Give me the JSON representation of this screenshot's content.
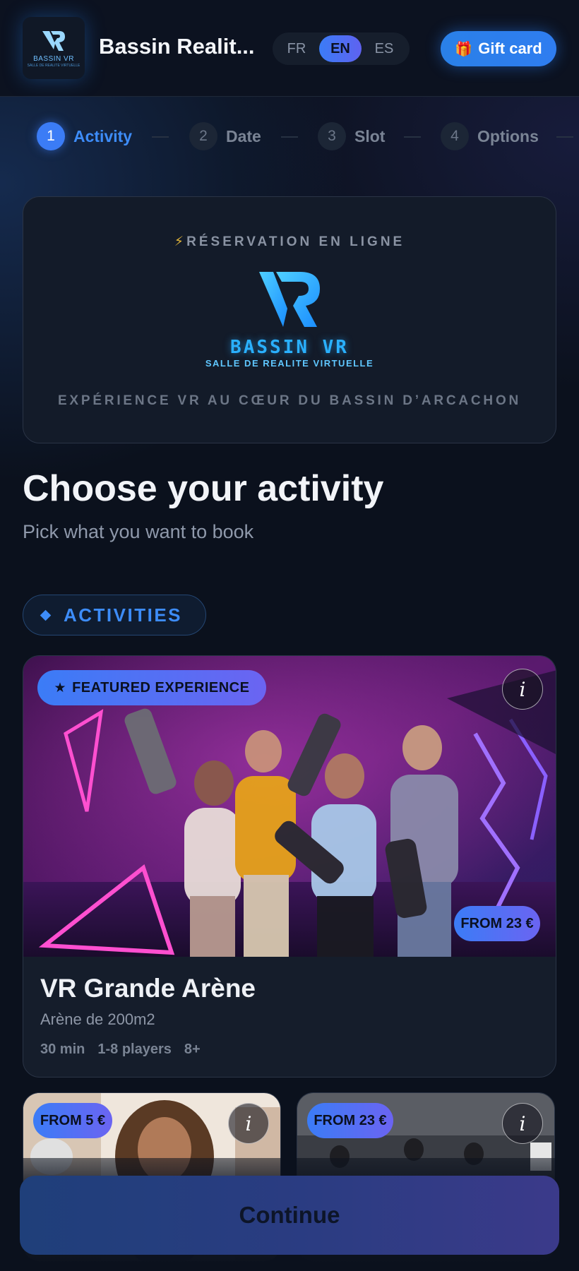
{
  "header": {
    "logo_text": "BASSIN VR",
    "logo_subtext": "SALLE DE REALITE VIRTUELLE",
    "brand_name": "Bassin Realit...",
    "languages": [
      "FR",
      "EN",
      "ES"
    ],
    "active_language": "EN",
    "gift_card_label": "Gift card",
    "gift_icon": "gift-icon"
  },
  "stepper": {
    "steps": [
      {
        "number": "1",
        "label": "Activity",
        "active": true
      },
      {
        "number": "2",
        "label": "Date",
        "active": false
      },
      {
        "number": "3",
        "label": "Slot",
        "active": false
      },
      {
        "number": "4",
        "label": "Options",
        "active": false
      }
    ]
  },
  "hero": {
    "kicker_icon": "⚡",
    "kicker": "RÉSERVATION EN LIGNE",
    "brand": "BASSIN VR",
    "brand_sub": "SALLE DE REALITE VIRTUELLE",
    "tagline": "EXPÉRIENCE VR AU CŒUR DU BASSIN D’ARCACHON"
  },
  "main": {
    "title": "Choose your activity",
    "subtitle": "Pick what you want to book",
    "category_label": "ACTIVITIES"
  },
  "featured": {
    "badge": "FEATURED EXPERIENCE",
    "price": "FROM 23 €",
    "title": "VR Grande Arène",
    "subtitle": "Arène de 200m2",
    "duration": "30 min",
    "players": "1-8 players",
    "age": "8+",
    "info": "i"
  },
  "cards": [
    {
      "price": "FROM 5 €",
      "info": "i"
    },
    {
      "price": "FROM 23 €",
      "info": "i"
    }
  ],
  "footer": {
    "continue_label": "Continue"
  },
  "colors": {
    "accent": "#3b7cf6",
    "accent_secondary": "#6b64f2",
    "background": "#0b111d",
    "brand_cyan": "#2ab0ff"
  }
}
